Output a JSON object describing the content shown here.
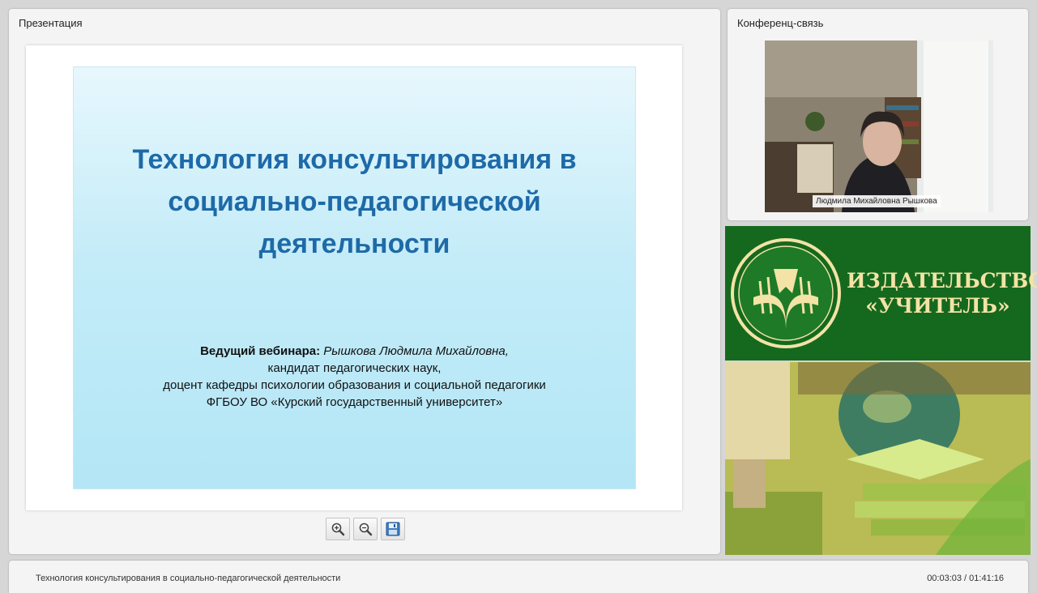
{
  "panels": {
    "presentation_title": "Презентация",
    "conference_title": "Конференц-связь"
  },
  "slide": {
    "title_line1": "Технология консультирования в",
    "title_line2": "социально-педагогической",
    "title_line3": "деятельности",
    "presenter_label": "Ведущий вебинара",
    "presenter_name": "Рышкова Людмила Михайловна,",
    "presenter_degree": "кандидат педагогических наук,",
    "presenter_position": "доцент кафедры психологии образования и социальной педагогики",
    "presenter_university": "ФГБОУ ВО «Курский государственный университет»"
  },
  "toolbar": {
    "zoom_in_icon": "zoom-in-icon",
    "zoom_out_icon": "zoom-out-icon",
    "save_icon": "save-icon"
  },
  "video": {
    "speaker_name": "Людмила Михайловна Рышкова"
  },
  "banner": {
    "publisher_line1": "ИЗДАТЕЛЬСТВО",
    "publisher_line2": "«УЧИТЕЛЬ»"
  },
  "footer": {
    "webinar_title": "Технология консультирования в социально-педагогической деятельности",
    "time": "00:03:03 / 01:41:16"
  },
  "colors": {
    "slide_title": "#1e6aa8",
    "banner_green": "#15691e",
    "banner_text": "#f3e3a6"
  }
}
